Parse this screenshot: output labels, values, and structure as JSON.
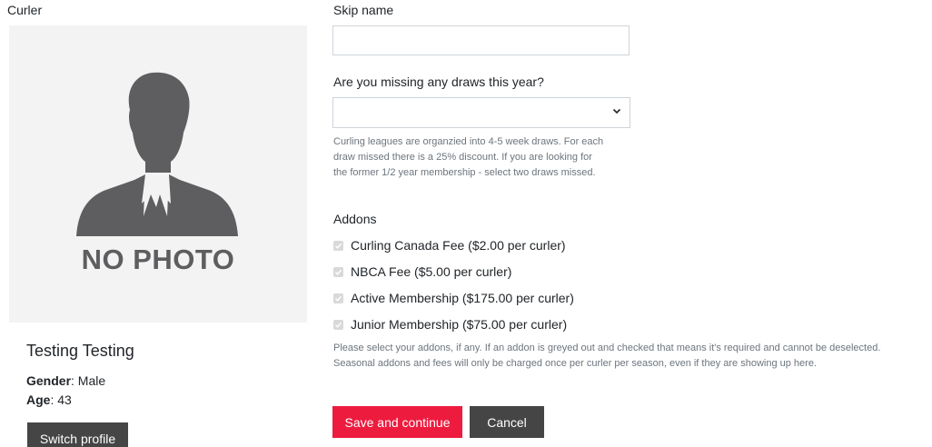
{
  "curler": {
    "label": "Curler",
    "photo_placeholder": "NO PHOTO",
    "name": "Testing Testing",
    "gender_label": "Gender",
    "gender_value": ": Male",
    "age_label": "Age",
    "age_value": ": 43",
    "switch_profile_label": "Switch profile"
  },
  "form": {
    "skip_name_label": "Skip name",
    "skip_name_value": "",
    "missing_draws_label": "Are you missing any draws this year?",
    "missing_draws_value": "",
    "missing_draws_help": [
      "Curling leagues are organzied into 4-5 week draws. For each",
      "draw missed there is a 25% discount. If you are looking for",
      "the former 1/2 year membership - select two draws missed."
    ],
    "addons_label": "Addons",
    "addons": [
      {
        "label": "Curling Canada Fee ($2.00 per curler)",
        "checked": true,
        "disabled": true
      },
      {
        "label": "NBCA Fee ($5.00 per curler)",
        "checked": true,
        "disabled": true
      },
      {
        "label": "Active Membership ($175.00 per curler)",
        "checked": true,
        "disabled": true
      },
      {
        "label": "Junior Membership ($75.00 per curler)",
        "checked": true,
        "disabled": true
      }
    ],
    "addons_help": [
      "Please select your addons, if any. If an addon is greyed out and checked that means it's required and cannot be deselected.",
      "Seasonal addons and fees will only be charged once per curler per season, even if they are showing up here."
    ],
    "save_label": "Save and continue",
    "cancel_label": "Cancel"
  },
  "colors": {
    "primary": "#ed1c3f",
    "secondary": "#454545",
    "photo_bg": "#f3f3f3",
    "silhouette": "#5e5e60"
  },
  "icons": {
    "select_arrow": "chevron-down-icon",
    "checkbox_mark": "checkmark-icon"
  }
}
